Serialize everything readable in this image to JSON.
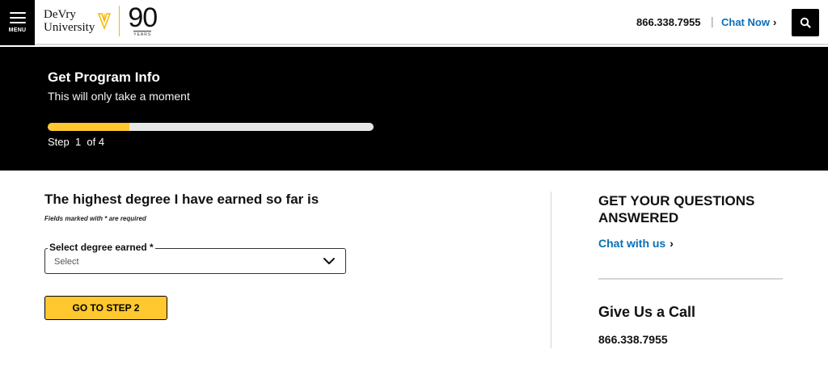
{
  "header": {
    "menu_label": "MENU",
    "logo": {
      "line1": "DeVry",
      "line2": "University",
      "anniversary": "90",
      "anniversary_sub": "YEARS"
    },
    "phone": "866.338.7955",
    "separator": "|",
    "chat_label": "Chat Now",
    "chevron": "›"
  },
  "hero": {
    "title": "Get Program Info",
    "subtitle": "This will only take a moment",
    "progress_fraction": 0.25,
    "step_text": "Step  1  of 4"
  },
  "form": {
    "title": "The highest degree I have earned so far is",
    "required_note": "Fields marked with * are required",
    "degree_select": {
      "label": "Select degree earned *",
      "value": "Select"
    },
    "next_button": "GO TO STEP 2"
  },
  "sidebar": {
    "title": "GET YOUR QUESTIONS ANSWERED",
    "chat_link": "Chat with us",
    "chevron": "›",
    "call_title": "Give Us a Call",
    "phone": "866.338.7955"
  },
  "colors": {
    "accent_yellow": "#ffc82e",
    "link_blue": "#0a6fb5",
    "hero_bg": "#000000"
  },
  "icons": {
    "menu": "hamburger-icon",
    "logo_mark": "devry-shield-icon",
    "search": "search-icon",
    "select": "chevron-down-icon",
    "link": "chevron-right-icon"
  }
}
